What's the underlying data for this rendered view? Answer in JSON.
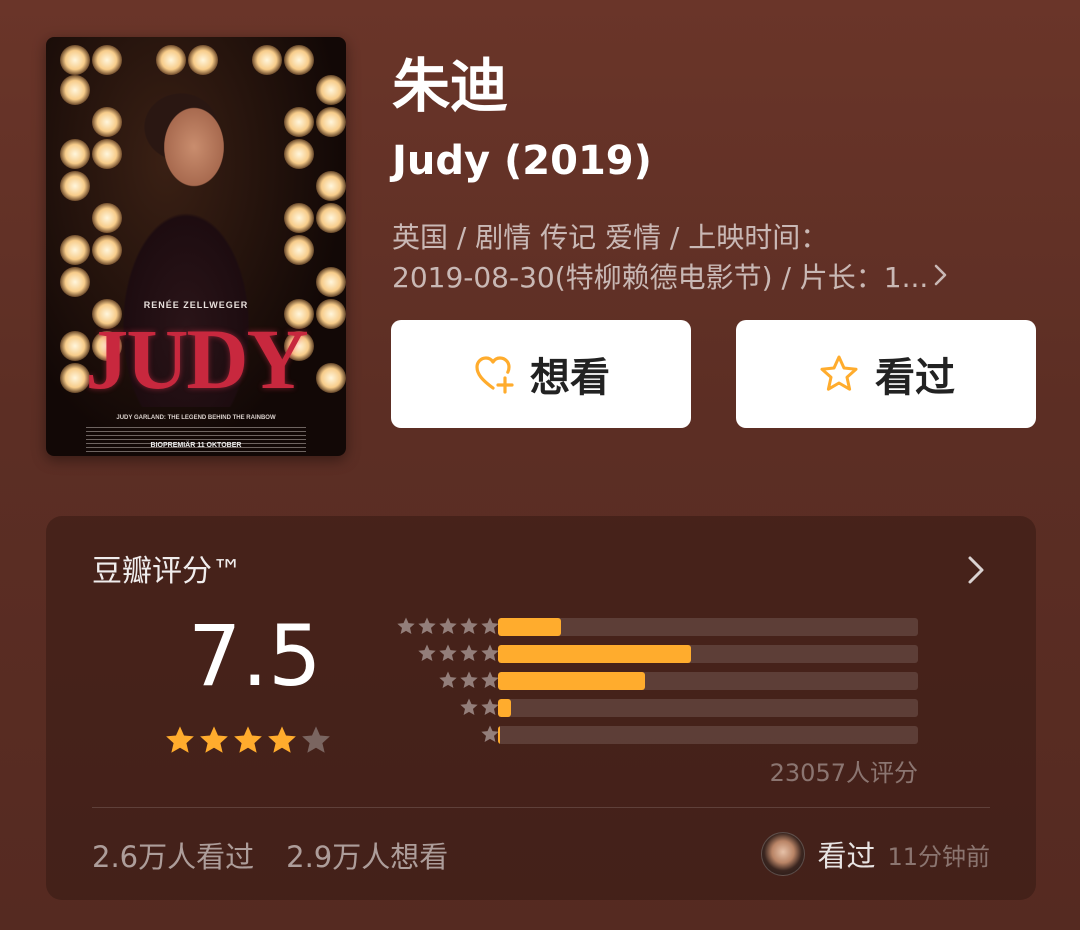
{
  "colors": {
    "background": "#5a2e24",
    "star_filled": "#ffac2d",
    "star_empty": "#7a6560",
    "bar_fill": "#ffac2d"
  },
  "poster": {
    "actor": "RENÉE ZELLWEGER",
    "title": "JUDY",
    "tagline": "JUDY GARLAND: THE LEGEND BEHIND THE RAINBOW",
    "premiere": "BIOPREMIÄR 11 OKTOBER"
  },
  "movie": {
    "title_cn": "朱迪",
    "title_en": "Judy (2019)",
    "meta_line1": "英国 / 剧情 传记 爱情 / 上映时间：",
    "meta_line2": "2019-08-30(特柳赖德电影节) / 片长：1...",
    "meta_more_icon": "chevron-right-icon"
  },
  "actions": {
    "want_label": "想看",
    "want_icon": "heart-plus-icon",
    "seen_label": "看过",
    "seen_icon": "star-outline-icon"
  },
  "rating": {
    "title": "豆瓣评分™",
    "score": "7.5",
    "stars_filled": 4,
    "stars_total": 5,
    "distribution": [
      {
        "stars": 5,
        "fraction": 0.15
      },
      {
        "stars": 4,
        "fraction": 0.46
      },
      {
        "stars": 3,
        "fraction": 0.35
      },
      {
        "stars": 2,
        "fraction": 0.03
      },
      {
        "stars": 1,
        "fraction": 0.005
      }
    ],
    "count_label": "23057人评分",
    "seen_count": "2.6万人看过",
    "want_count": "2.9万人想看",
    "activity_action": "看过",
    "activity_time": "11分钟前"
  }
}
